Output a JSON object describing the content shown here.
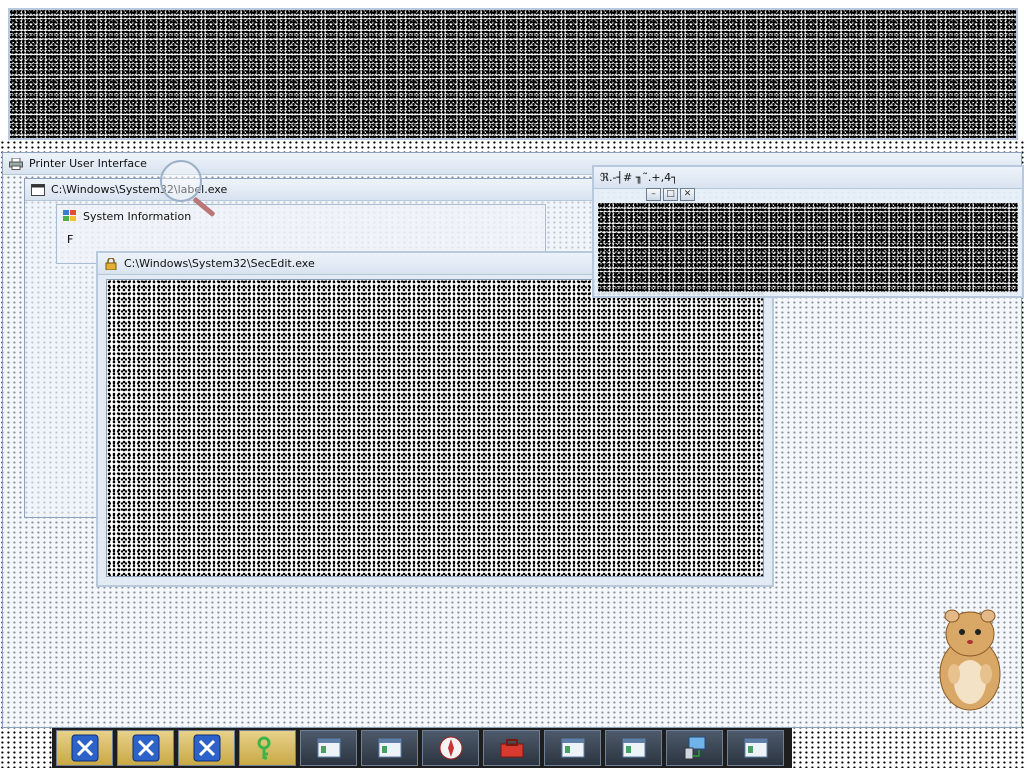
{
  "colors": {
    "titlebar_top": "#eef3fa",
    "titlebar_bottom": "#d8e3f0",
    "window_border": "#8aa2bd",
    "taskbar": "#1e1e1e",
    "taskbar_active": "#c9a944"
  },
  "windows": {
    "printer": {
      "title": "Printer User Interface",
      "icon": "printer-icon"
    },
    "label": {
      "title": "C:\\Windows\\System32\\label.exe",
      "icon": "console-icon"
    },
    "system_info": {
      "title": "System Information",
      "icon": "system-info-icon",
      "partial_text": "F"
    },
    "secedit": {
      "title": "C:\\Windows\\System32\\SecEdit.exe",
      "icon": "lock-app-icon"
    },
    "garbled": {
      "title": "ℜ.-┤#   ╖˜.+,4┐",
      "icon": "none"
    }
  },
  "window_controls": {
    "minimize": "–",
    "maximize": "□",
    "close": "✕"
  },
  "taskbar": {
    "items": [
      {
        "name": "close-x-icon",
        "active": true
      },
      {
        "name": "close-x-icon",
        "active": true
      },
      {
        "name": "close-x-icon",
        "active": true
      },
      {
        "name": "key-icon",
        "active": true
      },
      {
        "name": "window-app-icon",
        "active": false
      },
      {
        "name": "window-app-icon",
        "active": false
      },
      {
        "name": "compass-icon",
        "active": false
      },
      {
        "name": "toolbox-icon",
        "active": false
      },
      {
        "name": "window-app-icon",
        "active": false
      },
      {
        "name": "window-app-icon",
        "active": false
      },
      {
        "name": "network-computer-icon",
        "active": false
      },
      {
        "name": "window-app-icon",
        "active": false
      }
    ]
  }
}
